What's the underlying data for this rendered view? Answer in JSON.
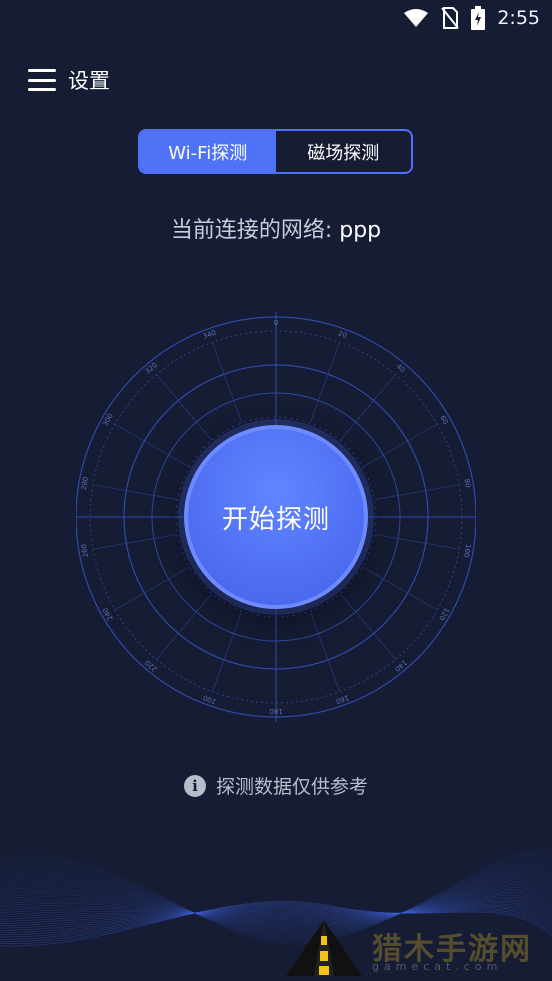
{
  "status_bar": {
    "time": "2:55"
  },
  "header": {
    "menu_icon": "hamburger-icon",
    "settings_label": "设置"
  },
  "tabs": [
    {
      "label": "Wi-Fi探测",
      "active": true
    },
    {
      "label": "磁场探测",
      "active": false
    }
  ],
  "network": {
    "label": "当前连接的网络:",
    "ssid": "ppp"
  },
  "dial": {
    "tick_labels": [
      "0",
      "20",
      "40",
      "60",
      "80",
      "100",
      "120",
      "140",
      "160",
      "180",
      "200",
      "220",
      "240",
      "260",
      "280",
      "300",
      "320",
      "340"
    ]
  },
  "start_button": {
    "label": "开始探测"
  },
  "note": {
    "icon": "info-icon",
    "text": "探测数据仅供参考"
  },
  "watermark": {
    "text": "猎木手游网",
    "sub": "gamecat.com"
  },
  "colors": {
    "background": "#151c33",
    "accent": "#4f72f6",
    "dial_line": "#2f4aa8"
  }
}
